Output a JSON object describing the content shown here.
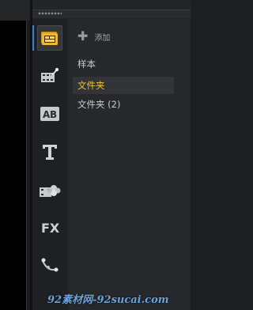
{
  "toolbar": {
    "add_label": "添加"
  },
  "library": {
    "items": [
      {
        "label": "样本",
        "selected": false
      },
      {
        "label": "文件夹",
        "selected": true
      },
      {
        "label": "文件夹 (2)",
        "selected": false
      }
    ]
  },
  "icons": [
    "media-icon",
    "instant-project-icon",
    "transition-ab-icon",
    "title-t-icon",
    "graphics-icon",
    "fx-filter-icon",
    "path-icon"
  ],
  "colors": {
    "accent": "#3d7fd6",
    "selected_text": "#e8c43a"
  },
  "watermark": "92素材网-92sucai.com"
}
